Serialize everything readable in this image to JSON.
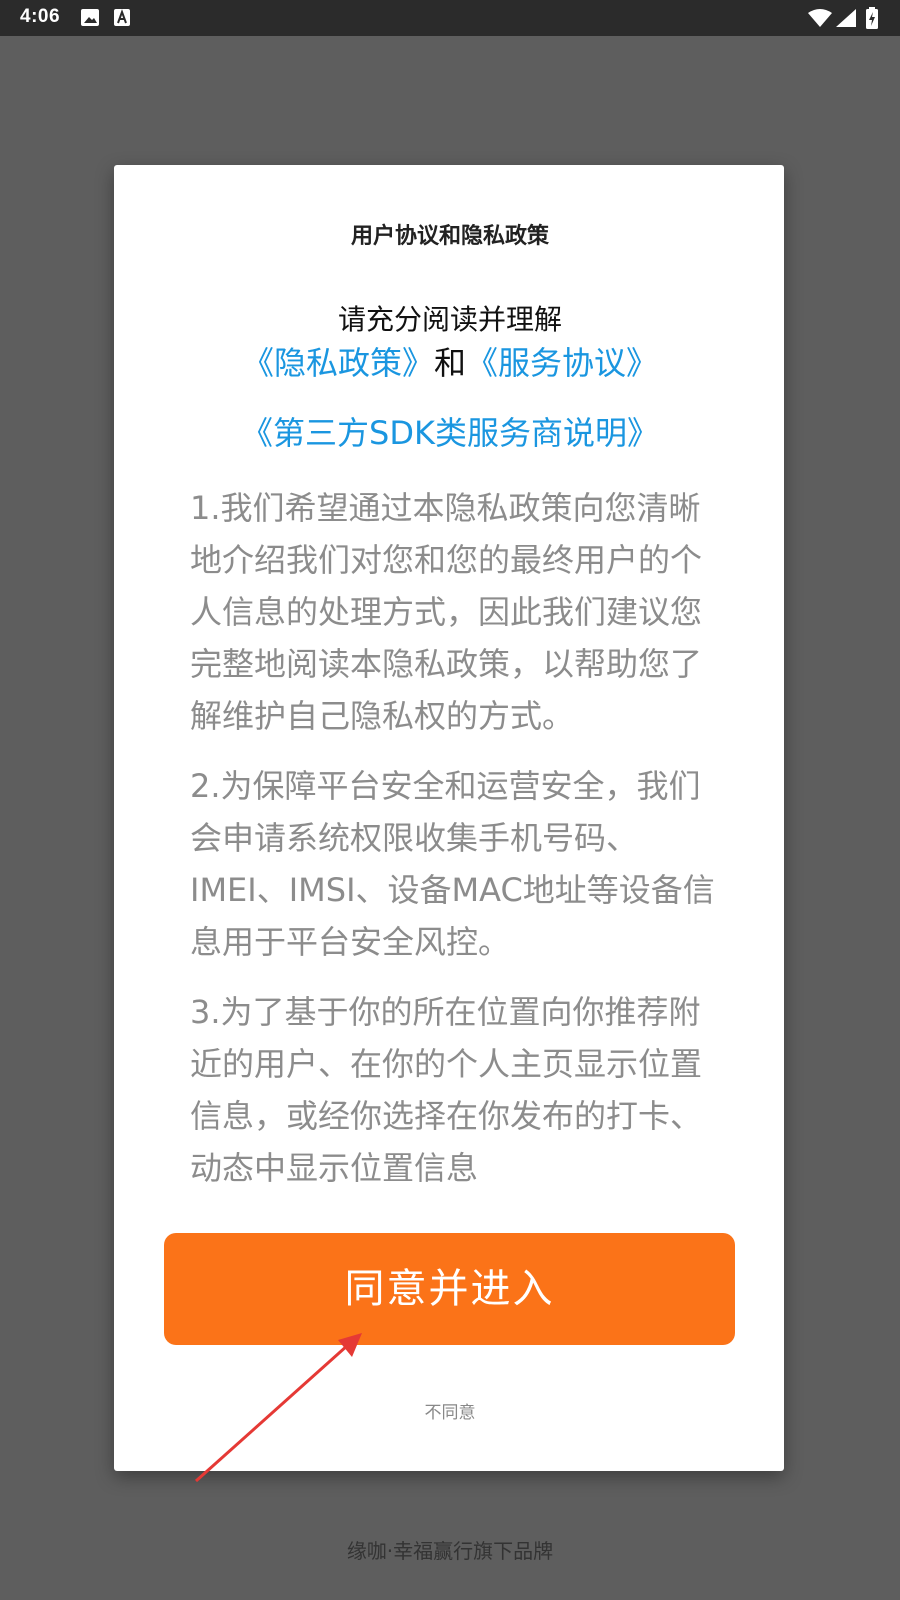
{
  "status_bar": {
    "time": "4:06",
    "left_icons": [
      "image-icon",
      "font-a-icon"
    ],
    "right_icons": [
      "wifi-icon",
      "signal-icon",
      "battery-charging-icon"
    ]
  },
  "dialog": {
    "title": "用户协议和隐私政策",
    "lead": "请充分阅读并理解",
    "privacy_link": "《隐私政策》",
    "and_text": "和",
    "service_link": "《服务协议》",
    "sdk_link": "《第三方SDK类服务商说明》",
    "paragraphs": [
      "1.我们希望通过本隐私政策向您清晰地介绍我们对您和您的最终用户的个人信息的处理方式，因此我们建议您完整地阅读本隐私政策，以帮助您了解维护自己隐私权的方式。",
      "2.为保障平台安全和运营安全，我们会申请系统权限收集手机号码、IMEI、IMSI、设备MAC地址等设备信息用于平台安全风控。",
      "3.为了基于你的所在位置向你推荐附近的用户、在你的个人主页显示位置信息，或经你选择在你发布的打卡、动态中显示位置信息"
    ],
    "agree_label": "同意并进入",
    "disagree_label": "不同意"
  },
  "footer": {
    "brand_text": "缘咖·幸福赢行旗下品牌"
  },
  "colors": {
    "accent_orange": "#fb7318",
    "link_blue": "#1a96e0",
    "overlay": "#5e5e5e",
    "status_bar": "#2b2b2b",
    "annotation_arrow": "#e53935"
  }
}
